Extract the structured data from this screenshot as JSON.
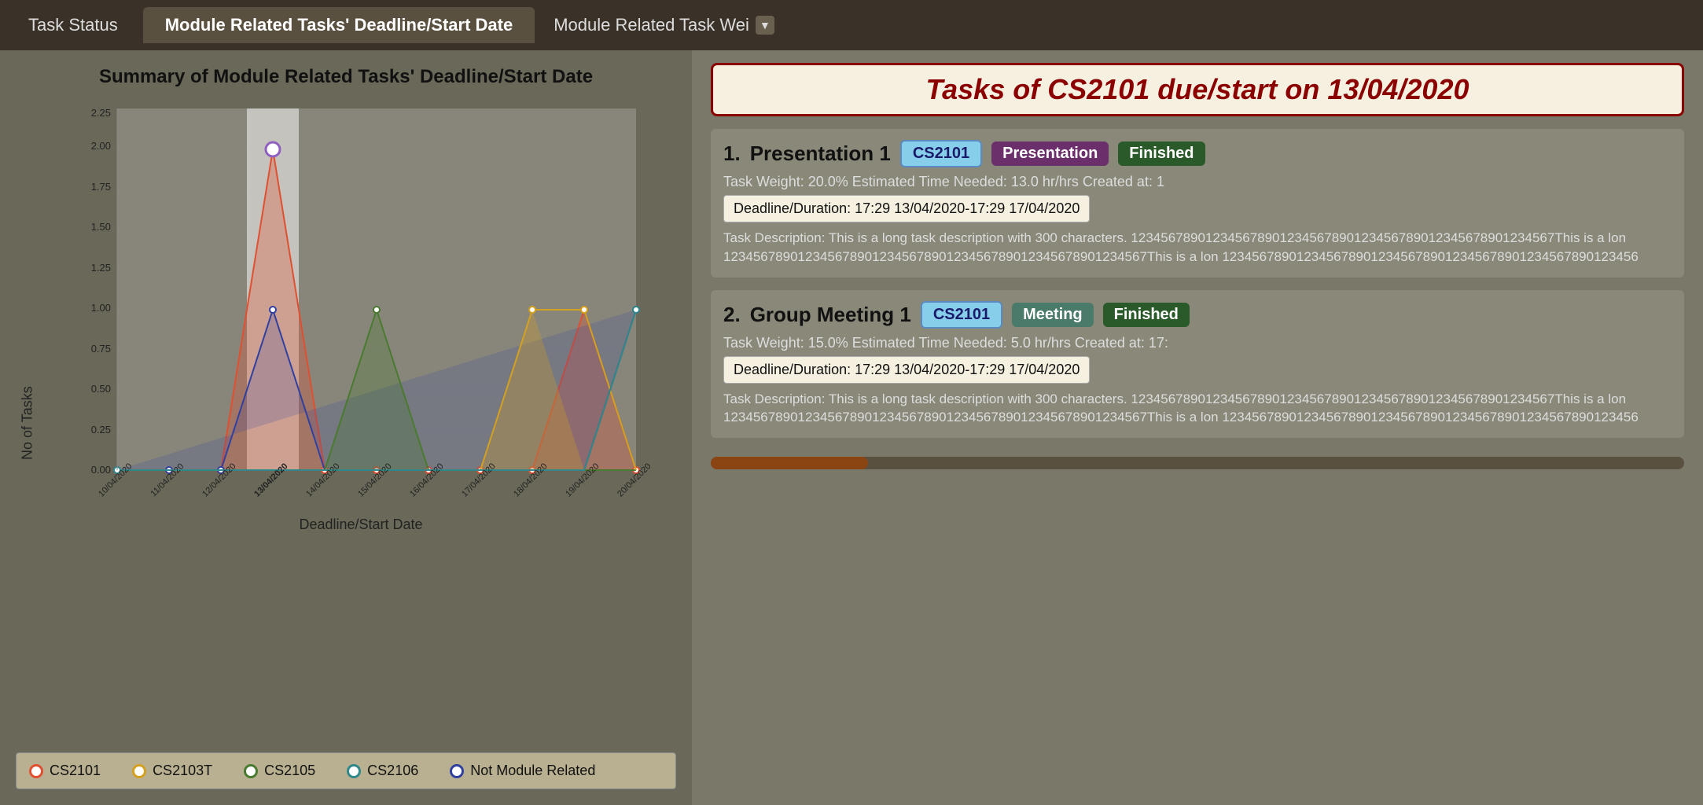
{
  "nav": {
    "tabs": [
      {
        "id": "task-status",
        "label": "Task Status",
        "active": false
      },
      {
        "id": "deadline-date",
        "label": "Module Related Tasks' Deadline/Start Date",
        "active": true
      },
      {
        "id": "task-weight",
        "label": "Module Related Task Wei",
        "active": false,
        "hasDropdown": true
      }
    ]
  },
  "chart": {
    "title": "Summary of Module Related Tasks' Deadline/Start Date",
    "yAxisLabel": "No of Tasks",
    "xAxisLabel": "Deadline/Start Date",
    "yTicks": [
      "0.00",
      "0.25",
      "0.50",
      "0.75",
      "1.00",
      "1.25",
      "1.50",
      "1.75",
      "2.00",
      "2.25"
    ],
    "xTicks": [
      "10/04/2020",
      "11/04/2020",
      "12/04/2020",
      "13/04/2020",
      "14/04/2020",
      "15/04/2020",
      "16/04/2020",
      "17/04/2020",
      "18/04/2020",
      "19/04/2020",
      "20/04/2020"
    ],
    "legend": [
      {
        "id": "CS2101",
        "label": "CS2101",
        "color": "#e05030",
        "active": true
      },
      {
        "id": "CS2103T",
        "label": "CS2103T",
        "color": "#d4a020"
      },
      {
        "id": "CS2105",
        "label": "CS2105",
        "color": "#4a7a30"
      },
      {
        "id": "CS2106",
        "label": "CS2106",
        "color": "#30888a"
      },
      {
        "id": "not-module",
        "label": "Not Module Related",
        "color": "#3040a0"
      }
    ],
    "highlighted_date": "13/04/2020"
  },
  "right_panel": {
    "title": "Tasks of CS2101 due/start on 13/04/2020",
    "tasks": [
      {
        "number": "1.",
        "name": "Presentation 1",
        "module_badge": "CS2101",
        "type_badge": "Presentation",
        "status_badge": "Finished",
        "meta": "Task Weight: 20.0%   Estimated Time Needed: 13.0 hr/hrs   Created at: 1",
        "deadline": "Deadline/Duration: 17:29 13/04/2020-17:29 17/04/2020",
        "description": "Task Description: This is a long task description with 300 characters. 123456789012345678901234567890123456789012345678901234567This is a lon 123456789012345678901234567890123456789012345678901234567This is a lon 12345678901234567890123456789012345678901234567890123456"
      },
      {
        "number": "2.",
        "name": "Group Meeting 1",
        "module_badge": "CS2101",
        "type_badge": "Meeting",
        "status_badge": "Finished",
        "meta": "Task Weight: 15.0%   Estimated Time Needed: 5.0 hr/hrs   Created at: 17:",
        "deadline": "Deadline/Duration: 17:29 13/04/2020-17:29 17/04/2020",
        "description": "Task Description: This is a long task description with 300 characters. 123456789012345678901234567890123456789012345678901234567This is a lon 123456789012345678901234567890123456789012345678901234567This is a lon 12345678901234567890123456789012345678901234567890123456"
      }
    ]
  }
}
